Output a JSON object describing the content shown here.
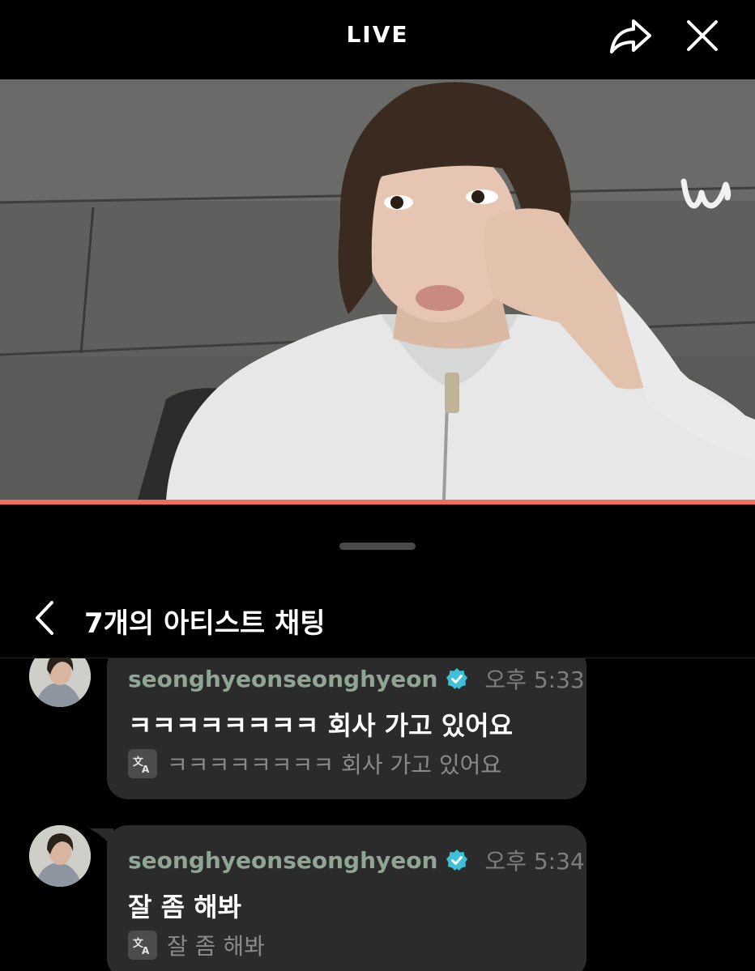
{
  "topbar": {
    "title": "LIVE",
    "share_icon": "share-arrow-icon",
    "close_icon": "close-icon"
  },
  "video": {
    "watermark_icon": "weverse-w-logo",
    "progress_fraction": 1.0,
    "progress_color": "#f06c5c"
  },
  "chat": {
    "back_icon": "chevron-left-icon",
    "title": "7개의 아티스트 채팅",
    "messages": [
      {
        "username": "seonghyeonseonghyeon",
        "time": "오후 5:33",
        "text": "ㅋㅋㅋㅋㅋㅋㅋㅋ 회사 가고 있어요",
        "translation": "ㅋㅋㅋㅋㅋㅋㅋㅋ 회사 가고 있어요"
      },
      {
        "username": "seonghyeonseonghyeon",
        "time": "오후 5:34",
        "text": "잘 좀 해봐",
        "translation": "잘 좀 해봐"
      }
    ]
  },
  "colors": {
    "background": "#000000",
    "bubble": "#2b2b2b",
    "username": "#8fa694",
    "verified": "#3ec0d8",
    "progress": "#f06c5c"
  }
}
